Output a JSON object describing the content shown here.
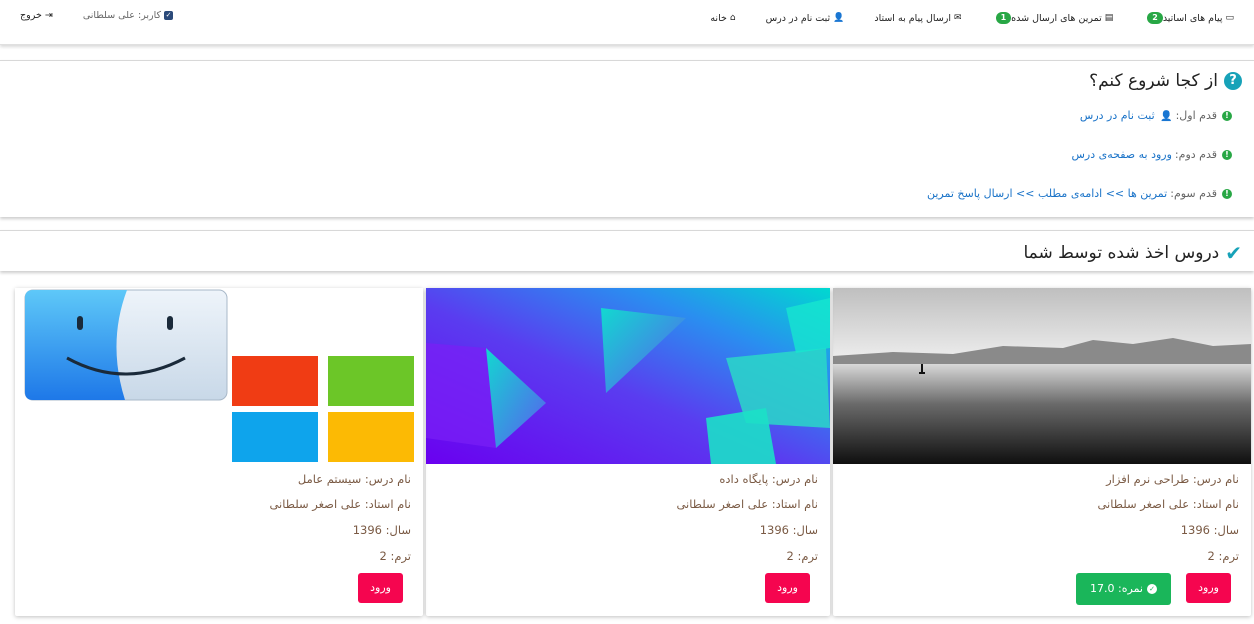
{
  "navbar": {
    "items": [
      {
        "label": "خانه",
        "icon": "home-icon"
      },
      {
        "label": "ثبت نام در درس",
        "icon": "user-plus-icon"
      },
      {
        "label": "ارسال پیام به استاد",
        "icon": "envelope-icon"
      },
      {
        "label": "تمرین های ارسال شده",
        "icon": "file-icon",
        "badge": "1"
      },
      {
        "label": "پیام های اساتید",
        "icon": "inbox-icon",
        "badge": "2"
      }
    ],
    "logout_label": "خروج",
    "user_label": "کاربر: علی سلطانی"
  },
  "getting_started": {
    "title": "از کجا شروع کنم؟",
    "steps": [
      {
        "prefix": "قدم اول:",
        "link": "ثبت نام در درس"
      },
      {
        "prefix": "قدم دوم:",
        "link": "ورود به صفحه‌ی درس"
      },
      {
        "prefix": "قدم سوم:",
        "link": "تمرین ها >> ادامه‌ی مطلب >> ارسال پاسخ تمرین"
      }
    ]
  },
  "courses_section": {
    "title": "دروس اخذ شده توسط شما"
  },
  "courses": [
    {
      "name": "نام درس: طراحی نرم افزار",
      "teacher": "نام استاد: علی اصغر سلطانی",
      "year": "سال: 1396",
      "term": "ترم: 2",
      "enter_label": "ورود",
      "grade_label": "نمره: 17.0"
    },
    {
      "name": "نام درس: پایگاه داده",
      "teacher": "نام استاد: علی اصغر سلطانی",
      "year": "سال: 1396",
      "term": "ترم: 2",
      "enter_label": "ورود"
    },
    {
      "name": "نام درس: سیستم عامل",
      "teacher": "نام استاد: علی اصغر سلطانی",
      "year": "سال: 1396",
      "term": "ترم: 2",
      "enter_label": "ورود"
    }
  ],
  "colors": {
    "accent": "#17a2b8",
    "badge": "#28a745",
    "enter_button": "#f5054f",
    "grade_button": "#1ab65a",
    "link": "#1a73c8"
  }
}
